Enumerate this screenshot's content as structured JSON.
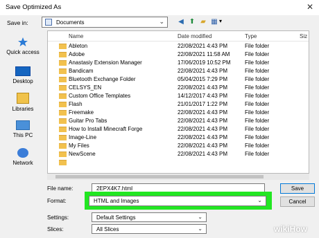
{
  "dialog": {
    "title": "Save Optimized As",
    "close_glyph": "✕"
  },
  "save_in": {
    "label": "Save in:",
    "value": "Documents"
  },
  "toolbar_icons": [
    "back-icon",
    "up-folder-icon",
    "new-folder-icon",
    "view-menu-icon"
  ],
  "places": [
    {
      "label": "Quick access",
      "icon": "quick-access-icon"
    },
    {
      "label": "Desktop",
      "icon": "desktop-icon"
    },
    {
      "label": "Libraries",
      "icon": "libraries-icon"
    },
    {
      "label": "This PC",
      "icon": "this-pc-icon"
    },
    {
      "label": "Network",
      "icon": "network-icon"
    }
  ],
  "columns": {
    "name": "Name",
    "date": "Date modified",
    "type": "Type",
    "size": "Siz"
  },
  "files": [
    {
      "name": "Ableton",
      "date": "22/08/2021 4:43 PM",
      "type": "File folder"
    },
    {
      "name": "Adobe",
      "date": "22/08/2021 11:58 AM",
      "type": "File folder"
    },
    {
      "name": "Anastasiy Extension Manager",
      "date": "17/06/2019 10:52 PM",
      "type": "File folder"
    },
    {
      "name": "Bandicam",
      "date": "22/08/2021 4:43 PM",
      "type": "File folder"
    },
    {
      "name": "Bluetooth Exchange Folder",
      "date": "05/04/2015 7:29 PM",
      "type": "File folder"
    },
    {
      "name": "CELSYS_EN",
      "date": "22/08/2021 4:43 PM",
      "type": "File folder"
    },
    {
      "name": "Custom Office Templates",
      "date": "14/12/2017 4:43 PM",
      "type": "File folder"
    },
    {
      "name": "Flash",
      "date": "21/01/2017 1:22 PM",
      "type": "File folder"
    },
    {
      "name": "Freemake",
      "date": "22/08/2021 4:43 PM",
      "type": "File folder"
    },
    {
      "name": "Guitar Pro Tabs",
      "date": "22/08/2021 4:43 PM",
      "type": "File folder"
    },
    {
      "name": "How to Install Minecraft Forge",
      "date": "22/08/2021 4:43 PM",
      "type": "File folder"
    },
    {
      "name": "Image-Line",
      "date": "22/08/2021 4:43 PM",
      "type": "File folder"
    },
    {
      "name": "My Files",
      "date": "22/08/2021 4:43 PM",
      "type": "File folder"
    },
    {
      "name": "NewScene",
      "date": "22/08/2021 4:43 PM",
      "type": "File folder"
    }
  ],
  "file_name": {
    "label": "File name:",
    "value": "2EPX4K7.html"
  },
  "format": {
    "label": "Format:",
    "value": "HTML and Images"
  },
  "settings": {
    "label": "Settings:",
    "value": "Default Settings"
  },
  "slices": {
    "label": "Slices:",
    "value": "All Slices"
  },
  "buttons": {
    "save": "Save",
    "cancel": "Cancel"
  },
  "watermark": "wikiHow",
  "colors": {
    "highlight": "#22e622",
    "folder": "#f2c14e",
    "accent": "#0078d7"
  }
}
